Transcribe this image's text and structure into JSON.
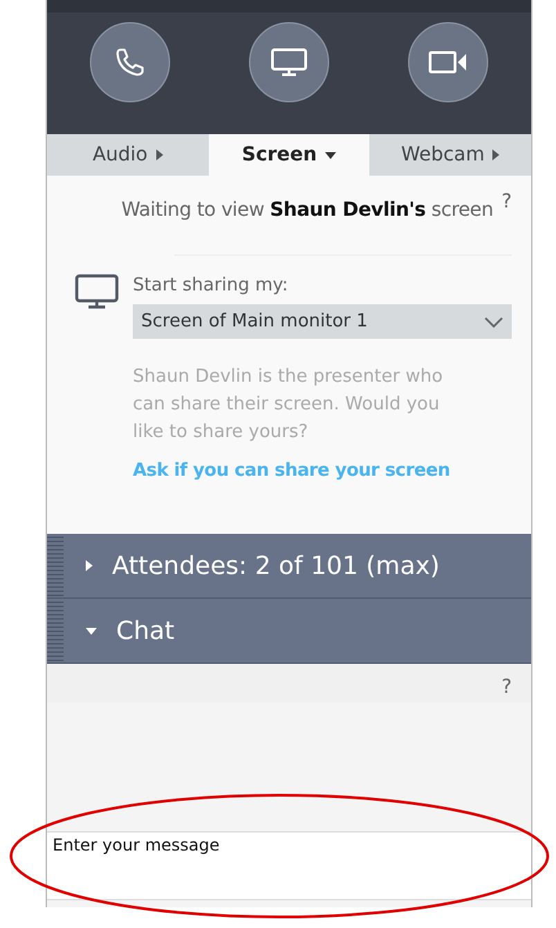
{
  "call_buttons": [
    {
      "kind": "phone"
    },
    {
      "kind": "screen"
    },
    {
      "kind": "camera"
    }
  ],
  "tabs": [
    {
      "label": "Audio",
      "selected": false
    },
    {
      "label": "Screen",
      "selected": true
    },
    {
      "label": "Webcam",
      "selected": false
    }
  ],
  "status": {
    "text": "Waiting to view **Shaun Devlin's** screen",
    "help": "?"
  },
  "share": {
    "label": "Start sharing my:",
    "dropdown_value": "Screen of Main monitor 1",
    "description": "Shaun Devlin is the presenter who can share their screen. Would you like to share yours?",
    "link": "Ask if you can share your screen"
  },
  "sections": [
    {
      "title": "Attendees:  2 of 101 (max)",
      "expanded": false
    },
    {
      "title": "Chat",
      "expanded": true
    }
  ],
  "chat": {
    "help": "?",
    "placeholder": "Enter your message"
  }
}
